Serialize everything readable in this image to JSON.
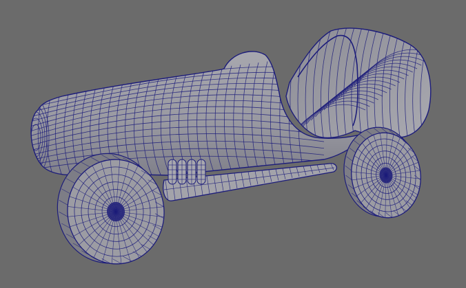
{
  "viewport": {
    "background": "#6b6b6b",
    "surface_color": "#9c9ca3",
    "surface_shadow": "#7d7d86",
    "wire_color": "#1c1c7a"
  }
}
